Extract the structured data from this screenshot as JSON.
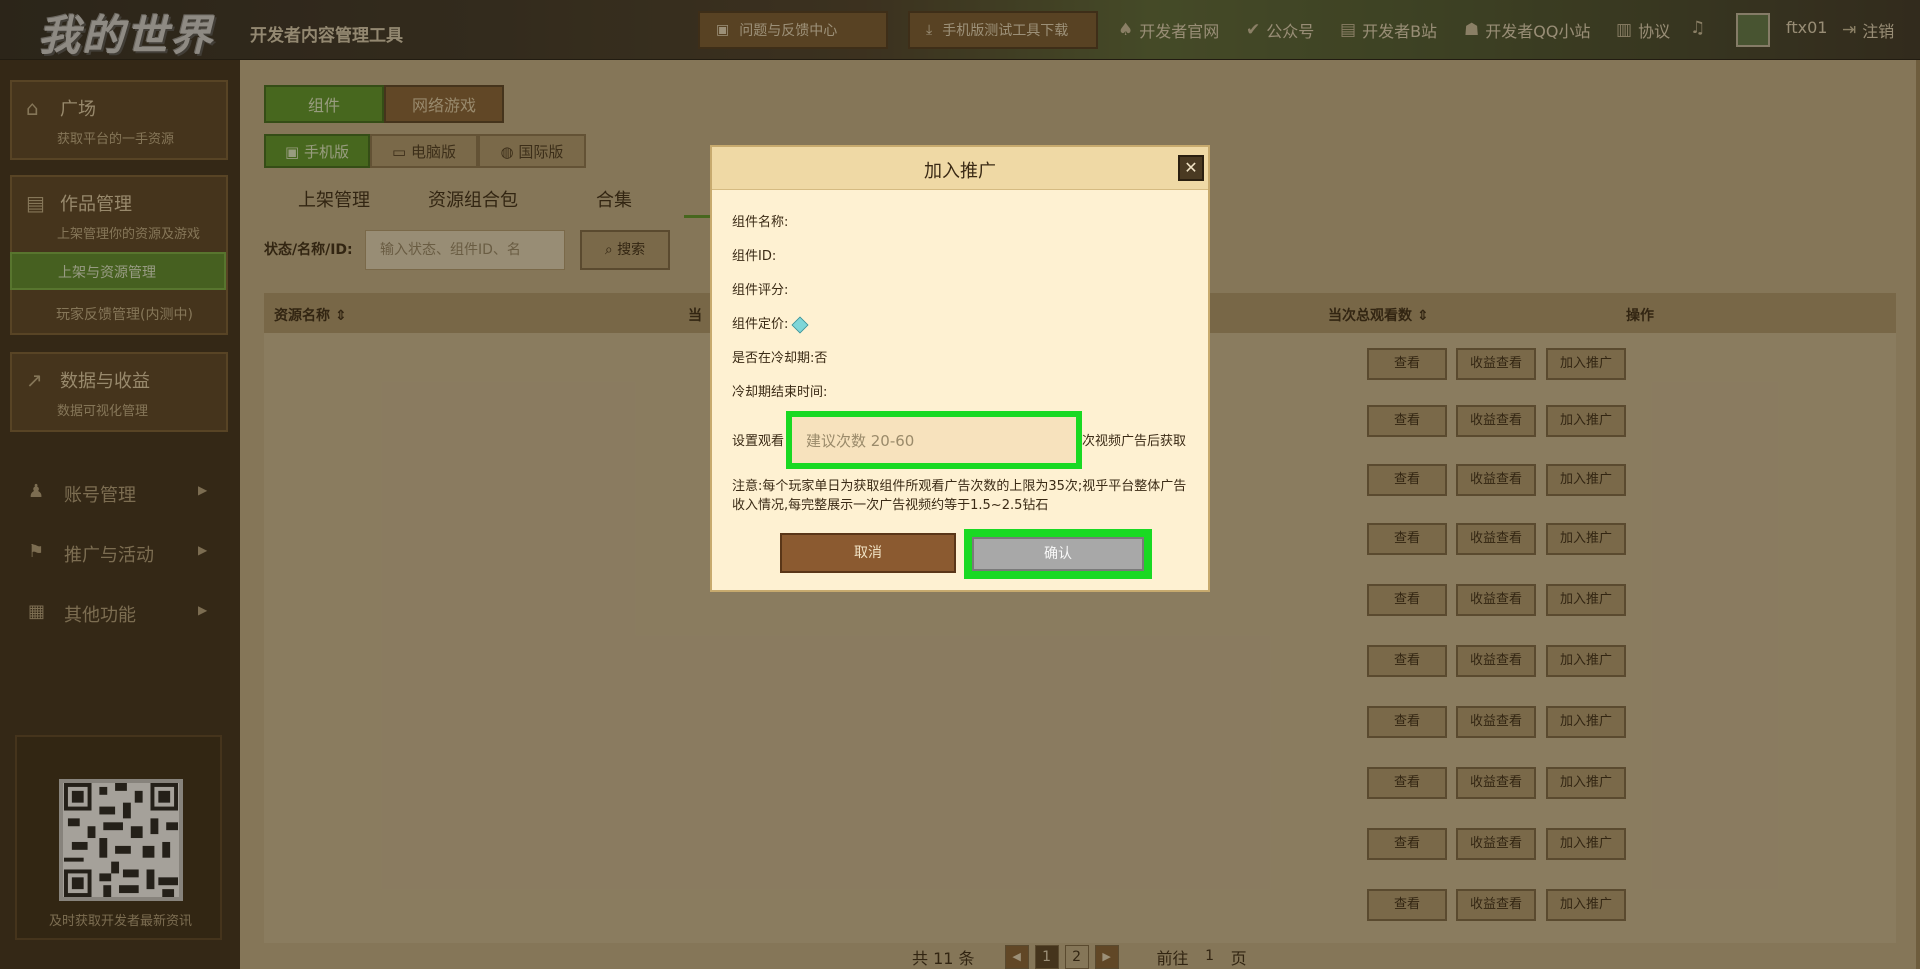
{
  "topbar": {
    "logo": "我的世界",
    "app_title": "开发者内容管理工具",
    "feedback_btn": "问题与反馈中心",
    "download_btn": "手机版测试工具下载",
    "links": [
      "开发者官网",
      "公众号",
      "开发者B站",
      "开发者QQ小站",
      "协议"
    ],
    "username": "ftx01",
    "logout": "注销"
  },
  "sidebar": {
    "plaza": {
      "title": "广场",
      "sub": "获取平台的一手资源"
    },
    "works": {
      "title": "作品管理",
      "sub": "上架管理你的资源及游戏"
    },
    "works_items": [
      "上架与资源管理",
      "玩家反馈管理(内测中)"
    ],
    "data": {
      "title": "数据与收益",
      "sub": "数据可视化管理"
    },
    "menus": [
      "账号管理",
      "推广与活动",
      "其他功能"
    ],
    "qr_text": "及时获取开发者最新资讯"
  },
  "main": {
    "top_tabs": [
      "组件",
      "网络游戏"
    ],
    "platforms": [
      "手机版",
      "电脑版",
      "国际版"
    ],
    "subtabs": [
      "上架管理",
      "资源组合包",
      "合集"
    ],
    "filter_label": "状态/名称/ID:",
    "filter_placeholder": "输入状态、组件ID、名",
    "search_btn": "搜索",
    "columns": [
      "资源名称",
      "当",
      "当次总观看数",
      "操作"
    ],
    "row_actions": [
      "查看",
      "收益查看",
      "加入推广"
    ],
    "row_count": 10,
    "pager": {
      "total": "共 11 条",
      "pages": [
        "1",
        "2"
      ],
      "goto": "前往",
      "goto_val": "1",
      "page_unit": "页"
    }
  },
  "modal": {
    "title": "加入推广",
    "fields": {
      "name": "组件名称:",
      "id": "组件ID:",
      "score": "组件评分:",
      "price": "组件定价:",
      "cooldown": "是否在冷却期:否",
      "cooldown_end": "冷却期结束时间:"
    },
    "set_label": "设置观看",
    "input_placeholder": "建议次数 20-60",
    "after_text": "次视频广告后获取",
    "notice": "注意:每个玩家单日为获取组件所观看广告次数的上限为35次;视乎平台整体广告收入情况,每完整展示一次广告视频约等于1.5~2.5钻石",
    "cancel": "取消",
    "confirm": "确认"
  },
  "colors": {
    "accent_green": "#5d9b2a",
    "highlight": "#19d923",
    "modal_bg": "#fef1d2"
  }
}
